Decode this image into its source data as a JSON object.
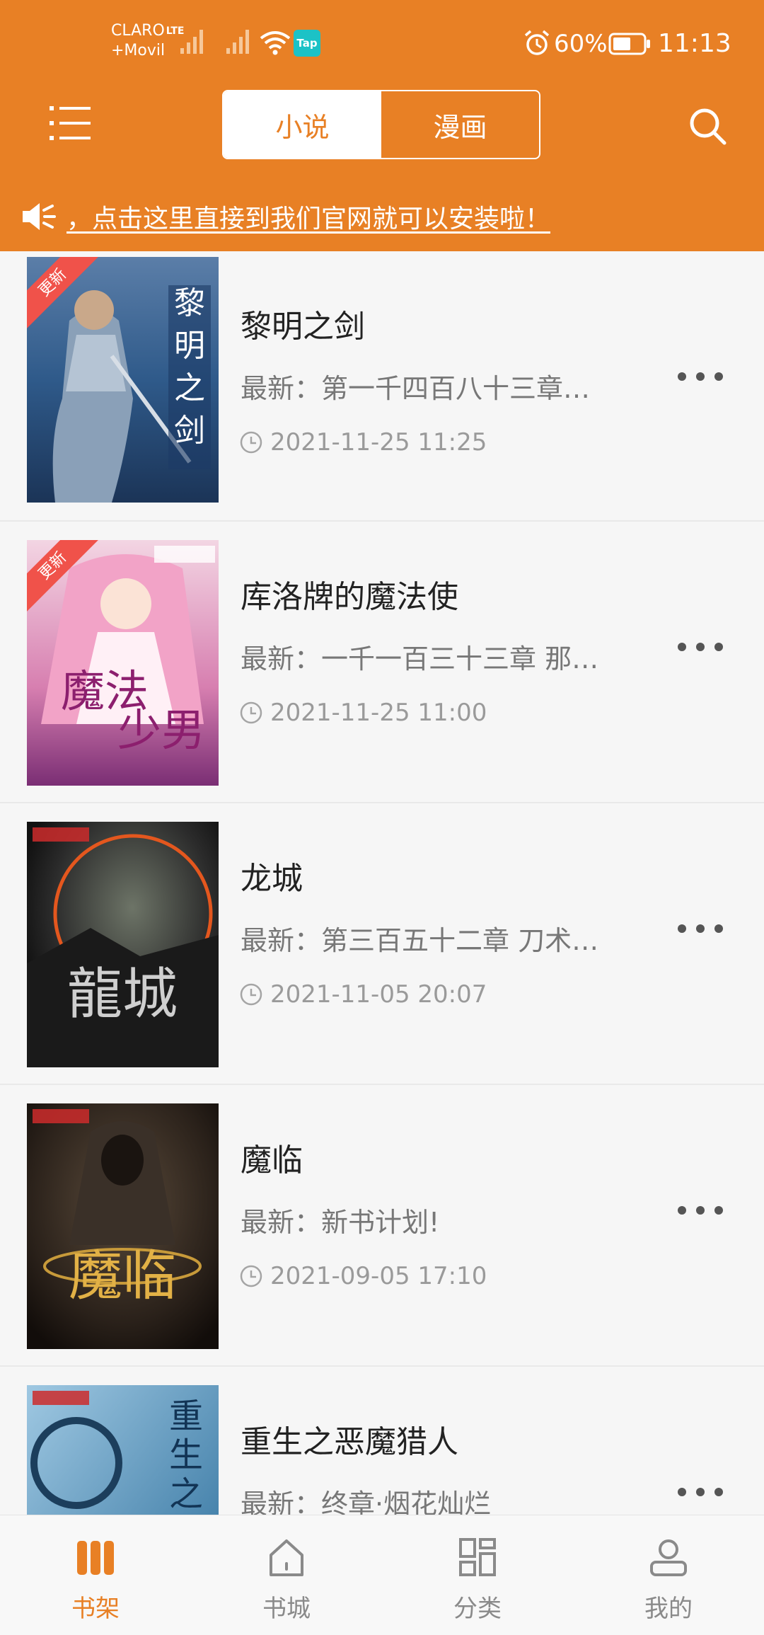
{
  "status_bar": {
    "carrier_line1": "CLARO",
    "carrier_lte": "LTE",
    "carrier_line2": "+Movil",
    "tap_badge": "Tap",
    "battery_percent": "60%",
    "time": "11:13",
    "icons": [
      "signal-icon",
      "wifi-icon",
      "alarm-icon",
      "battery-icon"
    ]
  },
  "header": {
    "tabs": [
      {
        "label": "小说",
        "active": true
      },
      {
        "label": "漫画",
        "active": false
      }
    ],
    "notice": "，点击这里直接到我们官网就可以安装啦！",
    "accent_color": "#e88025"
  },
  "books": [
    {
      "title": "黎明之剑",
      "latest": "最新：第一千四百八十三章…",
      "time": "2021-11-25 11:25",
      "ribbon": "更新"
    },
    {
      "title": "库洛牌的魔法使",
      "latest": "最新：一千一百三十三章 那…",
      "time": "2021-11-25 11:00",
      "ribbon": "更新"
    },
    {
      "title": "龙城",
      "latest": "最新：第三百五十二章 刀术…",
      "time": "2021-11-05 20:07",
      "ribbon": ""
    },
    {
      "title": "魔临",
      "latest": "最新：新书计划!",
      "time": "2021-09-05 17:10",
      "ribbon": ""
    },
    {
      "title": "重生之恶魔猎人",
      "latest": "最新：终章·烟花灿烂",
      "time": "",
      "ribbon": ""
    }
  ],
  "bottom_nav": [
    {
      "label": "书架",
      "icon": "bookshelf-icon",
      "active": true
    },
    {
      "label": "书城",
      "icon": "home-icon",
      "active": false
    },
    {
      "label": "分类",
      "icon": "category-icon",
      "active": false
    },
    {
      "label": "我的",
      "icon": "profile-icon",
      "active": false
    }
  ]
}
